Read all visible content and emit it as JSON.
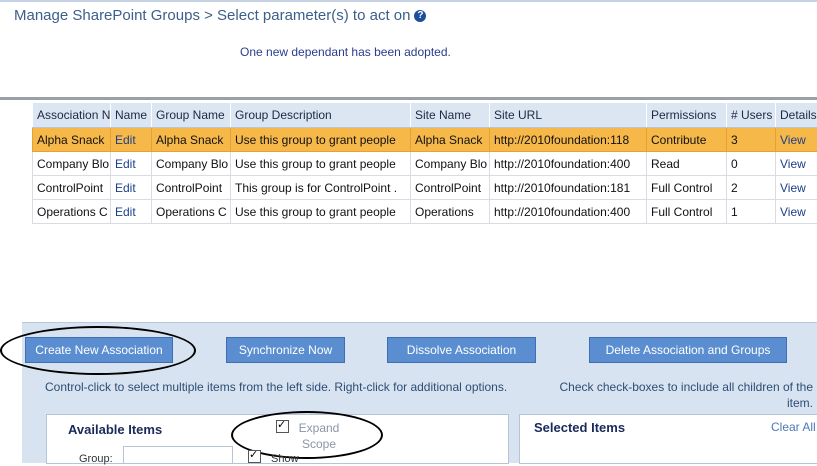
{
  "header": {
    "title": "Manage SharePoint Groups  > Select parameter(s) to act on",
    "help_glyph": "?",
    "message": "One new dependant has been adopted."
  },
  "table": {
    "columns": [
      "Association N",
      "Name",
      "Group Name",
      "Group Description",
      "Site Name",
      "Site URL",
      "Permissions",
      "# Users",
      "Details"
    ],
    "rows": [
      {
        "association": "Alpha Snack",
        "name": "Edit",
        "group_name": "Alpha Snack",
        "description": "Use this group to grant people",
        "site_name": "Alpha Snack",
        "site_url": "http://2010foundation:118",
        "permissions": "Contribute",
        "users": "3",
        "details": "View",
        "selected": true
      },
      {
        "association": "Company Blo",
        "name": "Edit",
        "group_name": "Company Blo",
        "description": "Use this group to grant people",
        "site_name": "Company Blo",
        "site_url": "http://2010foundation:400",
        "permissions": "Read",
        "users": "0",
        "details": "View",
        "selected": false
      },
      {
        "association": "ControlPoint",
        "name": "Edit",
        "group_name": "ControlPoint",
        "description": "This group is for ControlPoint .",
        "site_name": "ControlPoint",
        "site_url": "http://2010foundation:181",
        "permissions": "Full Control",
        "users": "2",
        "details": "View",
        "selected": false
      },
      {
        "association": "Operations C",
        "name": "Edit",
        "group_name": "Operations C",
        "description": "Use this group to grant people",
        "site_name": "Operations",
        "site_url": "http://2010foundation:400",
        "permissions": "Full Control",
        "users": "1",
        "details": "View",
        "selected": false
      }
    ]
  },
  "actions": {
    "create": "Create New Association",
    "sync": "Synchronize Now",
    "dissolve": "Dissolve Association",
    "delete": "Delete Association and Groups"
  },
  "hints": {
    "left": "Control-click to select multiple items from the left side. Right-click for additional options.",
    "right": "Check check-boxes to include all children of the item."
  },
  "available": {
    "title": "Available Items",
    "expand_scope": "Expand Scope",
    "group_label": "Group:",
    "show_label": "Show"
  },
  "selected": {
    "title": "Selected Items",
    "clear_all": "Clear All"
  },
  "colors": {
    "accent": "#5a8ed0",
    "selected_row": "#f7b84a",
    "panel": "#d8e3f1",
    "header_text": "#3b5f8a"
  }
}
